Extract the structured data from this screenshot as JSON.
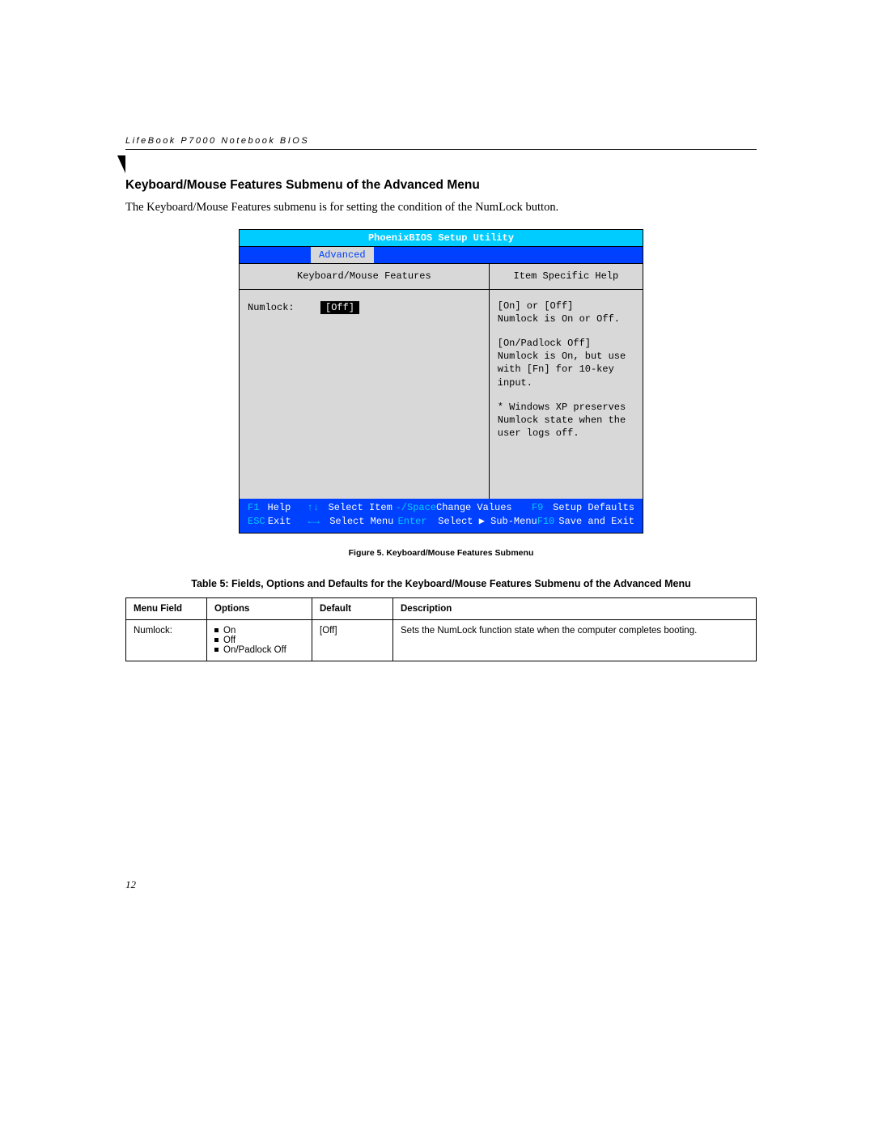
{
  "doc": {
    "running_header": "LifeBook P7000 Notebook BIOS",
    "page_number": "12"
  },
  "section": {
    "title": "Keyboard/Mouse Features Submenu of the Advanced Menu",
    "intro": "The Keyboard/Mouse Features submenu is for setting the condition of the NumLock button."
  },
  "bios": {
    "title": "PhoenixBIOS Setup Utility",
    "active_tab": "Advanced",
    "left_header": "Keyboard/Mouse Features",
    "right_header": "Item Specific Help",
    "field": {
      "label": "Numlock:",
      "value": "[Off]"
    },
    "help": {
      "line1": "[On] or [Off]",
      "line2": "Numlock is On or Off.",
      "line3": "[On/Padlock Off]",
      "line4": "Numlock is On, but use with [Fn] for 10-key input.",
      "line5": "* Windows XP preserves Numlock state when the user logs off."
    },
    "footer": {
      "f1": "F1",
      "f1_label": "Help",
      "esc": "ESC",
      "esc_label": "Exit",
      "updown": "↑↓",
      "updown_label": "Select Item",
      "leftright": "←→",
      "leftright_label": "Select Menu",
      "minusspace": "-/Space",
      "minusspace_label": "Change Values",
      "enter": "Enter",
      "enter_label": "Select ▶ Sub-Menu",
      "f9": "F9",
      "f9_label": "Setup Defaults",
      "f10": "F10",
      "f10_label": "Save and Exit"
    }
  },
  "figure_caption": "Figure 5.   Keyboard/Mouse Features Submenu",
  "table_caption": "Table 5: Fields, Options and Defaults for the Keyboard/Mouse Features Submenu of the Advanced Menu",
  "table": {
    "head": {
      "menu_field": "Menu Field",
      "options": "Options",
      "default": "Default",
      "description": "Description"
    },
    "row": {
      "menu_field": "Numlock:",
      "opt1": "On",
      "opt2": "Off",
      "opt3": "On/Padlock Off",
      "default": "[Off]",
      "description": "Sets the NumLock function state when the computer completes booting."
    }
  }
}
